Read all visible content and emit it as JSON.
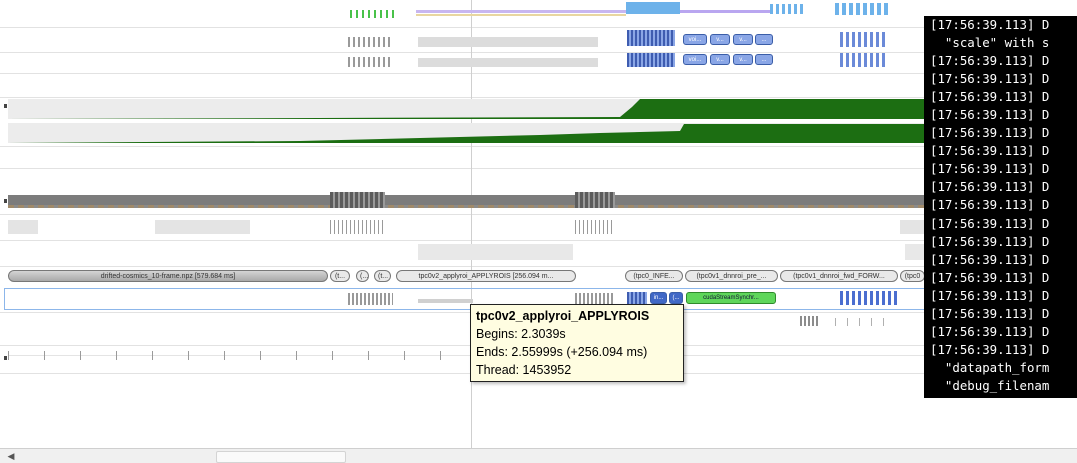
{
  "timeline": {
    "slices": [
      {
        "name": "slice-drifted-cosmics",
        "label": "drifted-cosmics_10-frame.npz [579.684 ms]"
      },
      {
        "name": "slice-t1",
        "label": "(t..."
      },
      {
        "name": "slice-t2",
        "label": "(..."
      },
      {
        "name": "slice-t3",
        "label": "(t..."
      },
      {
        "name": "slice-tpc0v2-applyroi",
        "label": "tpc0v2_applyroi_APPLYROIS [256.094 m..."
      },
      {
        "name": "slice-tpc0-infe",
        "label": "(tpc0_INFE..."
      },
      {
        "name": "slice-tpc0v1-dnnroi-pre",
        "label": "(tpc0v1_dnnroi_pre_..."
      },
      {
        "name": "slice-tpc0v1-dnnroi-fwd",
        "label": "(tpc0v1_dnnroi_fwd_FORW..."
      },
      {
        "name": "slice-tpc0",
        "label": "(tpc0"
      }
    ],
    "kernels_row1": [
      "voi...",
      "v...",
      "v...",
      "..."
    ],
    "kernels_row2": [
      "voi...",
      "v...",
      "v...",
      "..."
    ],
    "cuda_row": {
      "small1": "in...",
      "small2": "(...",
      "sync": "cudaStreamSynchr..."
    }
  },
  "tooltip": {
    "title": "tpc0v2_applyroi_APPLYROIS",
    "begins": "Begins: 2.3039s",
    "ends": "Ends: 2.55999s (+256.094 ms)",
    "thread": "Thread: 1453952"
  },
  "terminal": {
    "lines": [
      "[17:56:39.113] D",
      "  \"scale\" with s",
      "[17:56:39.113] D",
      "[17:56:39.113] D",
      "[17:56:39.113] D",
      "[17:56:39.113] D",
      "[17:56:39.113] D",
      "[17:56:39.113] D",
      "[17:56:39.113] D",
      "[17:56:39.113] D",
      "[17:56:39.113] D",
      "[17:56:39.113] D",
      "[17:56:39.113] D",
      "[17:56:39.113] D",
      "[17:56:39.113] D",
      "[17:56:39.113] D",
      "[17:56:39.113] D",
      "[17:56:39.113] D",
      "[17:56:39.113] D",
      "  \"datapath_form",
      "  \"debug_filenam"
    ]
  },
  "colors": {
    "green_fill": "#1c6e12",
    "cpu_bar": "#7c7c7c",
    "kernel_blue": "#8aa6e6",
    "cuda_green": "#5ed65a",
    "tooltip_bg": "#fffde1"
  }
}
